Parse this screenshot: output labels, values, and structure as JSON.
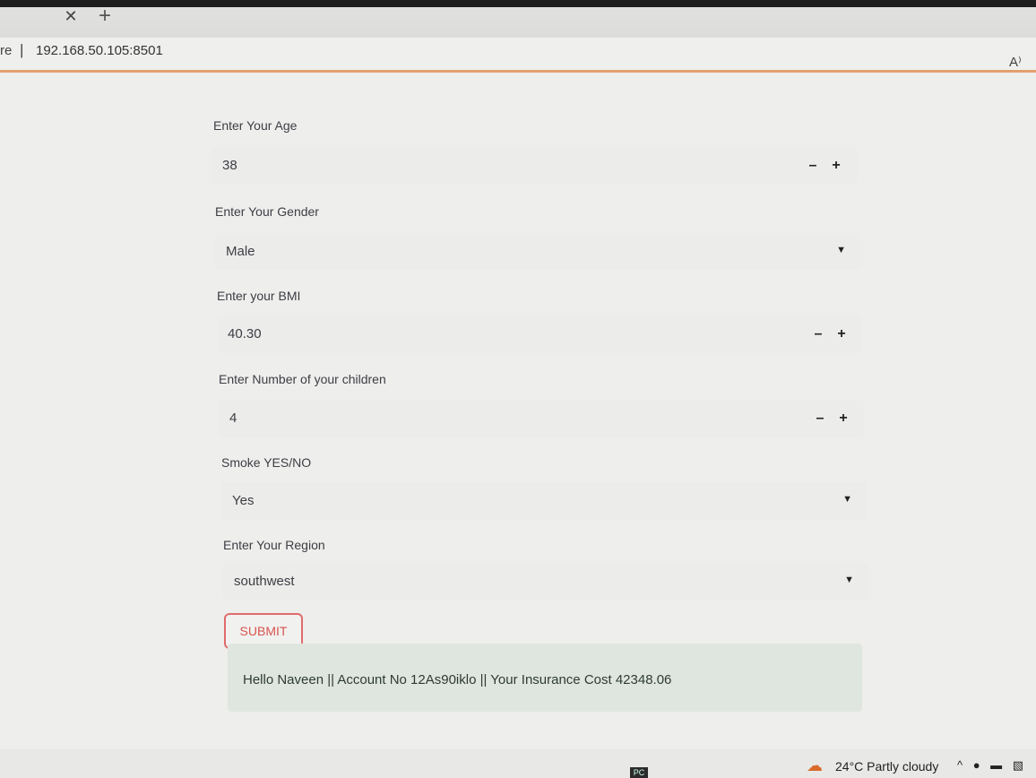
{
  "browser": {
    "tab_close_icon": "close-icon",
    "new_tab_icon": "plus-icon",
    "address_partial": "re",
    "address_separator": "|",
    "url": "192.168.50.105:8501",
    "read_aloud_label": "A⁾"
  },
  "form": {
    "age": {
      "label": "Enter Your Age",
      "value": "38",
      "minus": "–",
      "plus": "+"
    },
    "gender": {
      "label": "Enter Your Gender",
      "value": "Male"
    },
    "bmi": {
      "label": "Enter your BMI",
      "value": "40.30",
      "minus": "–",
      "plus": "+"
    },
    "children": {
      "label": "Enter Number of your children",
      "value": "4",
      "minus": "–",
      "plus": "+"
    },
    "smoker": {
      "label": "Smoke YES/NO",
      "value": "Yes"
    },
    "region": {
      "label": "Enter Your Region",
      "value": "southwest"
    },
    "submit_label": "SUBMIT",
    "result": "Hello Naveen || Account No 12As90iklo || Your Insurance Cost 42348.06"
  },
  "taskbar": {
    "weather": "24°C  Partly cloudy",
    "tray_icons": "^ ● ▬ ▧",
    "app_label": "PC"
  },
  "colors": {
    "accent": "#e06b6b",
    "result_bg": "#dfe6e0",
    "load_bar": "#e2a070"
  }
}
